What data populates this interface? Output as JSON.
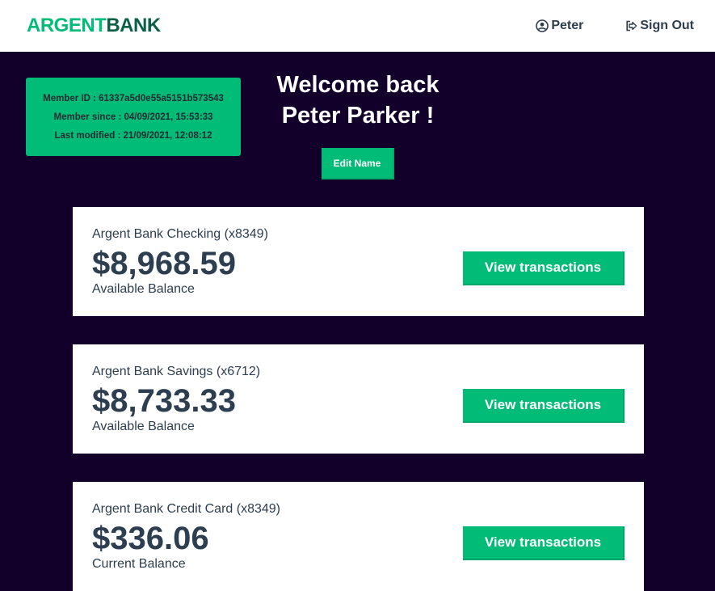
{
  "brand": {
    "part1": "ARGENT",
    "part2": "BANK"
  },
  "nav": {
    "user_label": "Peter",
    "signout_label": "Sign Out"
  },
  "member": {
    "id_line": "Member ID : 61337a5d0e55a5151b573543",
    "since_line": "Member since : 04/09/2021, 15:53:33",
    "modified_line": "Last modified : 21/09/2021, 12:08:12"
  },
  "welcome": {
    "line1": "Welcome back",
    "line2": "Peter Parker !"
  },
  "edit_label": "Edit Name",
  "accounts": [
    {
      "title": "Argent Bank Checking (x8349)",
      "amount": "$8,968.59",
      "description": "Available Balance",
      "button": "View transactions"
    },
    {
      "title": "Argent Bank Savings (x6712)",
      "amount": "$8,733.33",
      "description": "Available Balance",
      "button": "View transactions"
    },
    {
      "title": "Argent Bank Credit Card (x8349)",
      "amount": "$336.06",
      "description": "Current Balance",
      "button": "View transactions"
    }
  ],
  "colors": {
    "background": "#12002b",
    "accent": "#00bc77",
    "brand_dark": "#0a5f47",
    "text": "#2c3e50"
  },
  "icons": {
    "user": "user-circle-icon",
    "signout": "sign-out-icon"
  }
}
